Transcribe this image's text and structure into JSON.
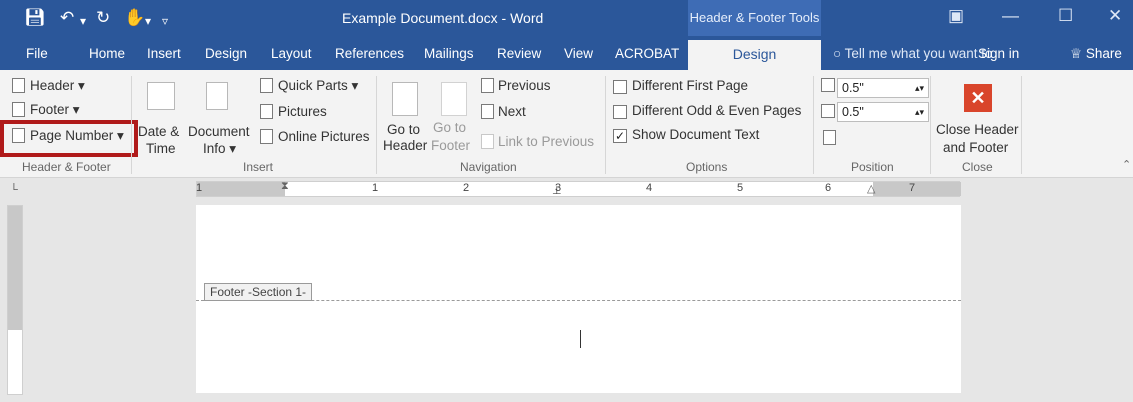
{
  "title_bar": {
    "document_title": "Example Document.docx - Word",
    "contextual_group": "Header & Footer Tools"
  },
  "menu": {
    "items": [
      "File",
      "Home",
      "Insert",
      "Design",
      "Layout",
      "References",
      "Mailings",
      "Review",
      "View",
      "ACROBAT"
    ],
    "active_tab": "Design",
    "tell_me": "Tell me what you want to",
    "sign_in": "Sign in",
    "share": "Share"
  },
  "ribbon": {
    "header_footer": {
      "header": "Header",
      "footer": "Footer",
      "page_number": "Page Number",
      "label": "Header & Footer"
    },
    "insert": {
      "date_time_1": "Date &",
      "date_time_2": "Time",
      "document_info_1": "Document",
      "document_info_2": "Info",
      "quick_parts": "Quick Parts",
      "pictures": "Pictures",
      "online_pictures": "Online Pictures",
      "label": "Insert"
    },
    "navigation": {
      "go_to_header_1": "Go to",
      "go_to_header_2": "Header",
      "go_to_footer_1": "Go to",
      "go_to_footer_2": "Footer",
      "previous": "Previous",
      "next": "Next",
      "link_to_previous": "Link to Previous",
      "label": "Navigation"
    },
    "options": {
      "different_first_page": "Different First Page",
      "different_odd_even": "Different Odd & Even Pages",
      "show_document_text": "Show Document Text",
      "label": "Options"
    },
    "position": {
      "header_from_top": "0.5\"",
      "footer_from_bottom": "0.5\"",
      "label": "Position"
    },
    "close": {
      "close_1": "Close Header",
      "close_2": "and Footer",
      "label": "Close"
    }
  },
  "ruler": {
    "ticks": [
      "1",
      "1",
      "2",
      "3",
      "4",
      "5",
      "6",
      "7"
    ]
  },
  "document": {
    "footer_tag": "Footer -Section 1-"
  },
  "colors": {
    "title_bar": "#2b579a",
    "contextual_tab": "#3e6cb5",
    "highlight_box": "#b01a1a",
    "close_icon": "#d9452b"
  }
}
